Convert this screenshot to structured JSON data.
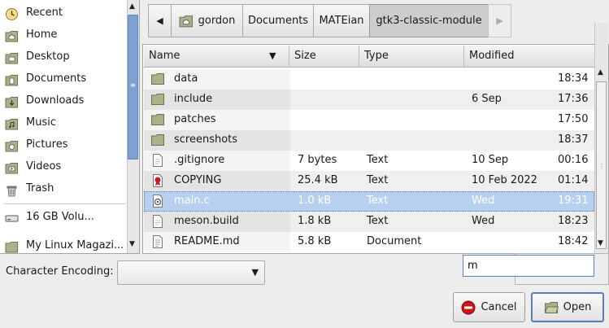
{
  "sidebar": {
    "items": [
      {
        "label": "Recent",
        "icon": "clock-icon"
      },
      {
        "label": "Home",
        "icon": "home-folder-icon"
      },
      {
        "label": "Desktop",
        "icon": "desktop-folder-icon"
      },
      {
        "label": "Documents",
        "icon": "documents-folder-icon"
      },
      {
        "label": "Downloads",
        "icon": "downloads-folder-icon"
      },
      {
        "label": "Music",
        "icon": "music-folder-icon"
      },
      {
        "label": "Pictures",
        "icon": "pictures-folder-icon"
      },
      {
        "label": "Videos",
        "icon": "videos-folder-icon"
      },
      {
        "label": "Trash",
        "icon": "trash-icon"
      }
    ],
    "devices": [
      {
        "label": "16 GB Volu...",
        "icon": "drive-icon"
      },
      {
        "label": "My Linux Magazi...",
        "icon": "folder-icon"
      }
    ]
  },
  "pathbar": {
    "segments": [
      "gordon",
      "Documents",
      "MATEian",
      "gtk3-classic-module"
    ]
  },
  "file_list": {
    "columns": [
      "Name",
      "Size",
      "Type",
      "Modified"
    ],
    "rows": [
      {
        "name": "data",
        "size": "",
        "type": "",
        "date": "",
        "time": "18:34",
        "icon": "folder-icon"
      },
      {
        "name": "include",
        "size": "",
        "type": "",
        "date": "6 Sep",
        "time": "17:36",
        "icon": "folder-icon"
      },
      {
        "name": "patches",
        "size": "",
        "type": "",
        "date": "",
        "time": "17:50",
        "icon": "folder-icon"
      },
      {
        "name": "screenshots",
        "size": "",
        "type": "",
        "date": "",
        "time": "18:37",
        "icon": "folder-icon"
      },
      {
        "name": ".gitignore",
        "size": "7 bytes",
        "type": "Text",
        "date": "10 Sep",
        "time": "00:16",
        "icon": "text-file-icon"
      },
      {
        "name": "COPYING",
        "size": "25.4 kB",
        "type": "Text",
        "date": "10 Feb 2022",
        "time": "01:14",
        "icon": "license-file-icon"
      },
      {
        "name": "main.c",
        "size": "1.0 kB",
        "type": "Text",
        "date": "Wed",
        "time": "19:31",
        "icon": "c-source-file-icon"
      },
      {
        "name": "meson.build",
        "size": "1.8 kB",
        "type": "Text",
        "date": "Wed",
        "time": "18:23",
        "icon": "text-file-icon"
      },
      {
        "name": "README.md",
        "size": "5.8 kB",
        "type": "Document",
        "date": "",
        "time": "18:42",
        "icon": "document-file-icon"
      }
    ],
    "selected_index": 6
  },
  "encoding": {
    "label": "Character Encoding:",
    "value": ""
  },
  "search": {
    "value": "m"
  },
  "buttons": {
    "cancel": "Cancel",
    "open": "Open"
  },
  "colors": {
    "selection": "#b8d0ef",
    "scroll_thumb": "#7ea1d4",
    "folder": "#a9b28a",
    "cancel_icon": "#d11414"
  }
}
